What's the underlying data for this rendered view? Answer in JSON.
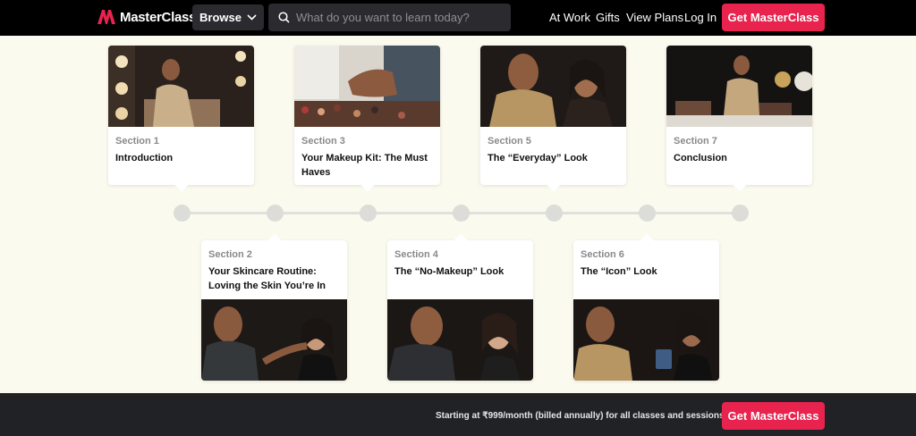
{
  "header": {
    "brand": "MasterClass",
    "browse_label": "Browse",
    "search_placeholder": "What do you want to learn today?",
    "nav_links": [
      "At Work",
      "Gifts",
      "View Plans",
      "Log In"
    ],
    "cta_label": "Get MasterClass",
    "brand_color": "#e7234e"
  },
  "sections": [
    {
      "label": "Section 1",
      "title": "Introduction"
    },
    {
      "label": "Section 2",
      "title": "Your Skincare Routine: Loving the Skin You’re In"
    },
    {
      "label": "Section 3",
      "title": "Your Makeup Kit: The Must Haves"
    },
    {
      "label": "Section 4",
      "title": "The “No-Makeup” Look"
    },
    {
      "label": "Section 5",
      "title": "The “Everyday” Look"
    },
    {
      "label": "Section 6",
      "title": "The “Icon” Look"
    },
    {
      "label": "Section 7",
      "title": "Conclusion"
    }
  ],
  "footer": {
    "pricing_text": "Starting at ₹999/month (billed annually) for all classes and sessions",
    "cta_label": "Get MasterClass"
  }
}
